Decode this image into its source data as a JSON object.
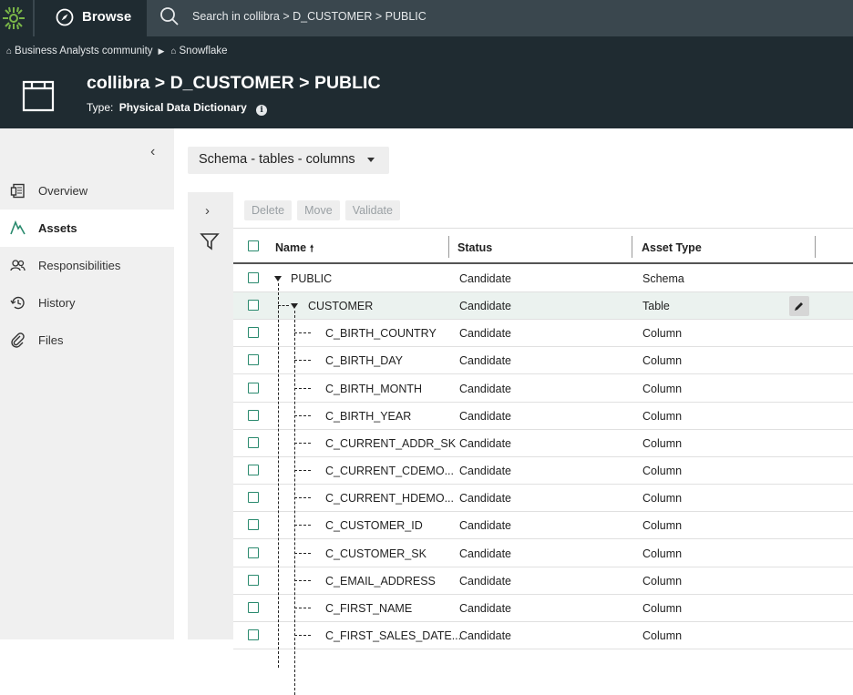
{
  "topbar": {
    "browse_label": "Browse",
    "search_placeholder": "Search in collibra > D_CUSTOMER > PUBLIC",
    "colors": {
      "bar": "#3a474e",
      "dark": "#1f2b31",
      "logo": "#7ab648"
    }
  },
  "header": {
    "breadcrumbs": [
      "Business Analysts community",
      "Snowflake"
    ],
    "title": "collibra > D_CUSTOMER > PUBLIC",
    "type_label": "Type:",
    "type_value": "Physical Data Dictionary"
  },
  "sidebar": {
    "items": [
      {
        "label": "Overview",
        "icon": "overview-icon",
        "active": false
      },
      {
        "label": "Assets",
        "icon": "assets-icon",
        "active": true
      },
      {
        "label": "Responsibilities",
        "icon": "responsibilities-icon",
        "active": false
      },
      {
        "label": "History",
        "icon": "history-icon",
        "active": false
      },
      {
        "label": "Files",
        "icon": "paperclip-icon",
        "active": false
      }
    ]
  },
  "main": {
    "view_label": "Schema - tables - columns",
    "toolbar": {
      "delete": "Delete",
      "move": "Move",
      "validate": "Validate"
    },
    "columns": {
      "name": "Name",
      "status": "Status",
      "asset_type": "Asset Type"
    },
    "rows": [
      {
        "name": "PUBLIC",
        "status": "Candidate",
        "type": "Schema",
        "level": 0
      },
      {
        "name": "CUSTOMER",
        "status": "Candidate",
        "type": "Table",
        "level": 1,
        "highlighted": true
      },
      {
        "name": "C_BIRTH_COUNTRY",
        "status": "Candidate",
        "type": "Column",
        "level": 2
      },
      {
        "name": "C_BIRTH_DAY",
        "status": "Candidate",
        "type": "Column",
        "level": 2
      },
      {
        "name": "C_BIRTH_MONTH",
        "status": "Candidate",
        "type": "Column",
        "level": 2
      },
      {
        "name": "C_BIRTH_YEAR",
        "status": "Candidate",
        "type": "Column",
        "level": 2
      },
      {
        "name": "C_CURRENT_ADDR_SK",
        "status": "Candidate",
        "type": "Column",
        "level": 2
      },
      {
        "name": "C_CURRENT_CDEMO...",
        "status": "Candidate",
        "type": "Column",
        "level": 2
      },
      {
        "name": "C_CURRENT_HDEMO...",
        "status": "Candidate",
        "type": "Column",
        "level": 2
      },
      {
        "name": "C_CUSTOMER_ID",
        "status": "Candidate",
        "type": "Column",
        "level": 2
      },
      {
        "name": "C_CUSTOMER_SK",
        "status": "Candidate",
        "type": "Column",
        "level": 2
      },
      {
        "name": "C_EMAIL_ADDRESS",
        "status": "Candidate",
        "type": "Column",
        "level": 2
      },
      {
        "name": "C_FIRST_NAME",
        "status": "Candidate",
        "type": "Column",
        "level": 2
      },
      {
        "name": "C_FIRST_SALES_DATE...",
        "status": "Candidate",
        "type": "Column",
        "level": 2
      }
    ]
  }
}
